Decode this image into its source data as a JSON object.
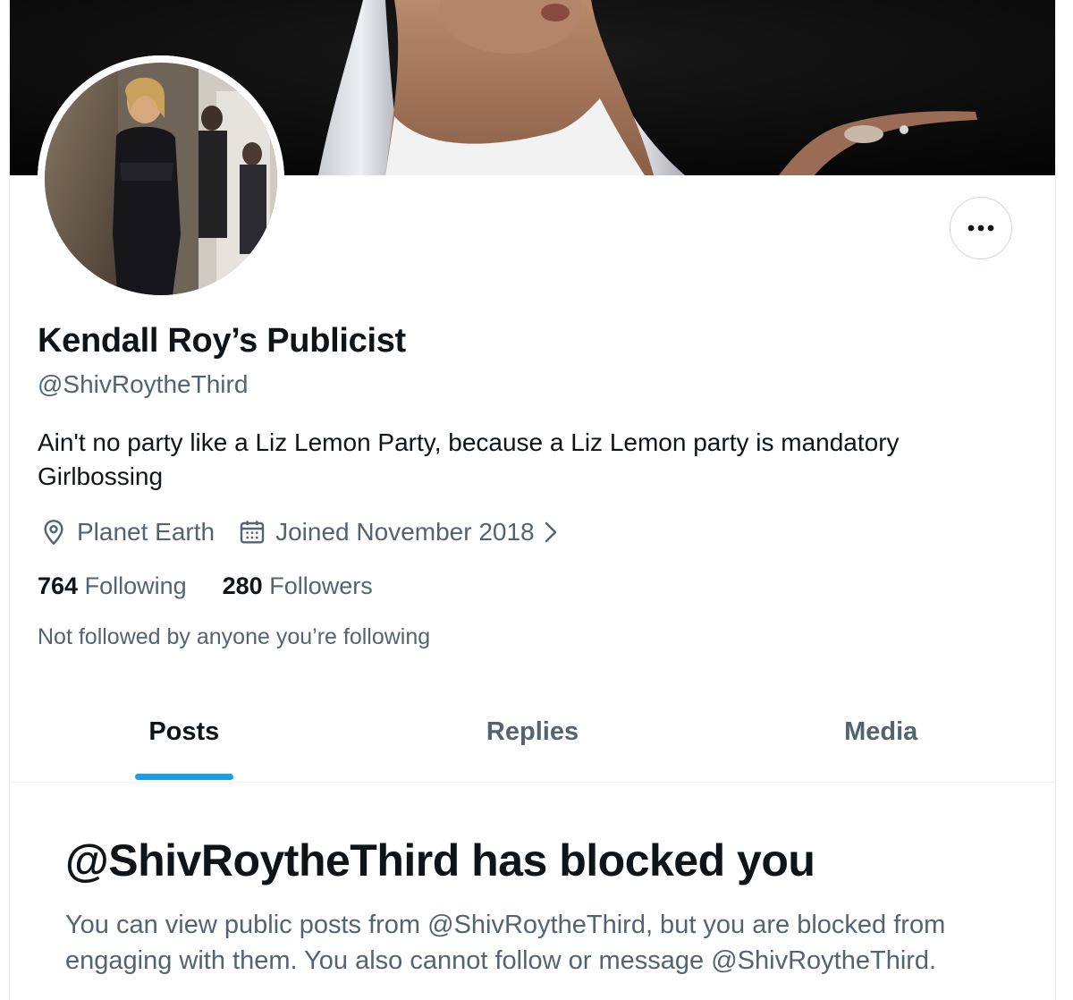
{
  "profile": {
    "display_name": "Kendall Roy’s Publicist",
    "handle": "@ShivRoytheThird",
    "bio_lines": [
      "Ain't no party like a Liz Lemon Party, because a Liz Lemon party is mandatory",
      "Girlbossing"
    ],
    "location": "Planet Earth",
    "joined": "Joined November 2018",
    "following_count": "764",
    "following_label": "Following",
    "followers_count": "280",
    "followers_label": "Followers",
    "not_followed_text": "Not followed by anyone you’re following"
  },
  "icons": {
    "more": "more-dots-icon",
    "location": "location-pin-icon",
    "calendar": "calendar-icon",
    "chevron": "chevron-right-icon"
  },
  "tabs": [
    {
      "label": "Posts",
      "active": true
    },
    {
      "label": "Replies",
      "active": false
    },
    {
      "label": "Media",
      "active": false
    }
  ],
  "blocked": {
    "title": "@ShivRoytheThird has blocked you",
    "message_lines": [
      "You can view public posts from @ShivRoytheThird, but you are blocked from",
      "engaging with them. You also cannot follow or message @ShivRoytheThird."
    ]
  },
  "colors": {
    "text_primary": "#0f1419",
    "text_secondary": "#536471",
    "accent": "#1d9bf0",
    "border": "#cfd9de"
  }
}
